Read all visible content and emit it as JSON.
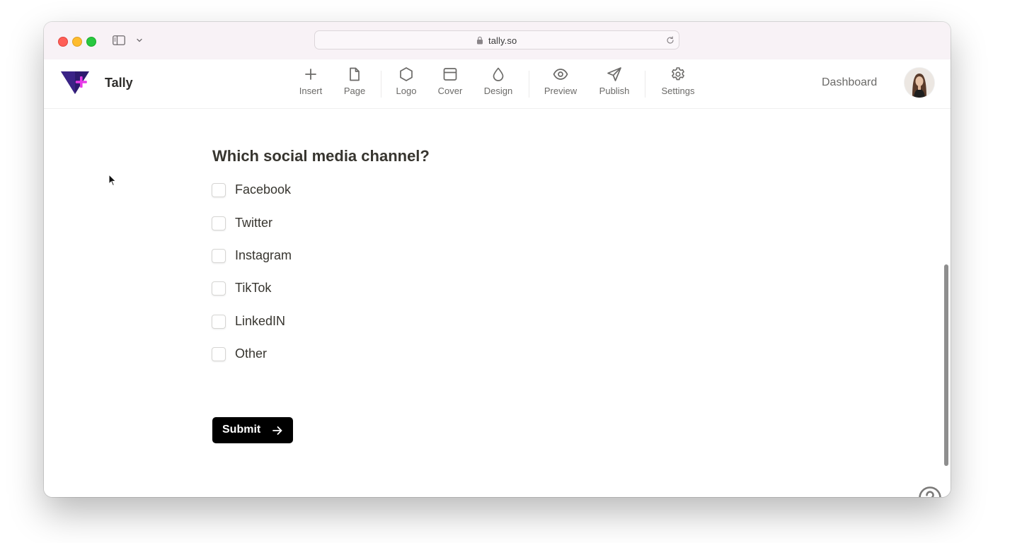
{
  "browser": {
    "url": "tally.so"
  },
  "app": {
    "brand": "Tally",
    "toolbar": [
      {
        "label": "Insert",
        "icon": "plus-icon"
      },
      {
        "label": "Page",
        "icon": "page-icon"
      },
      {
        "label": "Logo",
        "icon": "hexagon-icon"
      },
      {
        "label": "Cover",
        "icon": "cover-icon"
      },
      {
        "label": "Design",
        "icon": "droplet-icon"
      },
      {
        "label": "Preview",
        "icon": "eye-icon"
      },
      {
        "label": "Publish",
        "icon": "send-icon"
      },
      {
        "label": "Settings",
        "icon": "gear-icon"
      }
    ],
    "dashboard_label": "Dashboard"
  },
  "form": {
    "question": "Which social media channel?",
    "options": [
      {
        "label": "Facebook",
        "checked": false
      },
      {
        "label": "Twitter",
        "checked": false
      },
      {
        "label": "Instagram",
        "checked": false
      },
      {
        "label": "TikTok",
        "checked": false
      },
      {
        "label": "LinkedIN",
        "checked": false
      },
      {
        "label": "Other",
        "checked": false
      }
    ],
    "submit_label": "Submit"
  },
  "colors": {
    "accent": "#000000",
    "logo_primary": "#2d1a6e",
    "logo_plus": "#e83be8"
  }
}
